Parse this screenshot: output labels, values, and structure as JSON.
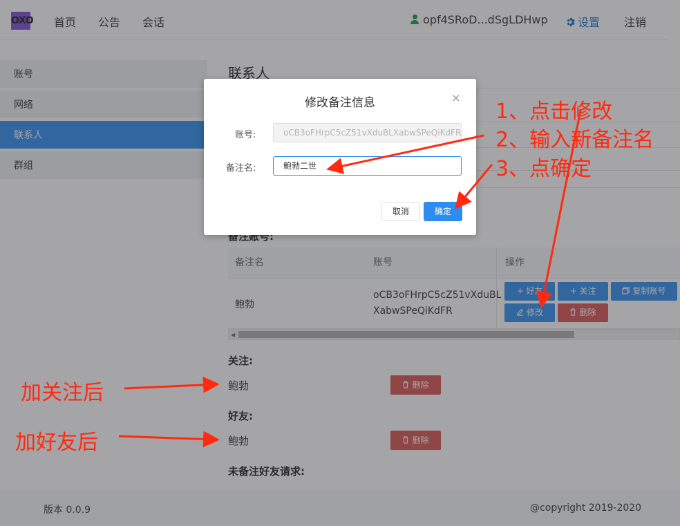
{
  "header": {
    "logo": "OXO",
    "nav": [
      "首页",
      "公告",
      "会话"
    ],
    "user": "opf4SRoD...dSgLDHwp",
    "settings": "设置",
    "logout": "注销"
  },
  "sidebar": {
    "items": [
      {
        "label": "账号"
      },
      {
        "label": "网络"
      },
      {
        "label": "联系人",
        "active": true
      },
      {
        "label": "群组"
      }
    ]
  },
  "main": {
    "title": "联系人",
    "remark_section": "备注账号:",
    "table": {
      "columns": [
        "备注名",
        "账号",
        "操作"
      ],
      "rows": [
        {
          "remark": "鲍勃",
          "account_line1": "oCB3oFHrpC5cZ51vXduBL",
          "account_line2": "XabwSPeQiKdFR",
          "actions": {
            "friend": "+ 好友",
            "follow": "+ 关注",
            "copy": "复制账号",
            "modify": "修改",
            "delete": "删除"
          }
        }
      ]
    },
    "follow_section": "关注:",
    "follow_items": [
      {
        "name": "鲍勃",
        "delete": "删除"
      }
    ],
    "friend_section": "好友:",
    "friend_items": [
      {
        "name": "鲍勃",
        "delete": "删除"
      }
    ],
    "pending_section": "未备注好友请求:"
  },
  "footer": {
    "version": "版本 0.0.9",
    "copyright": "@copyright 2019-2020"
  },
  "modal": {
    "title": "修改备注信息",
    "close": "×",
    "account_label": "账号:",
    "account_value": "oCB3oFHrpC5cZ51vXduBLXabwSPeQiKdFR",
    "remark_label": "备注名:",
    "remark_value": "鲍勃二世",
    "cancel": "取消",
    "ok": "确定"
  },
  "annotations": {
    "step1": "1、点击修改",
    "step2": "2、输入新备注名",
    "step3": "3、点确定",
    "after_follow": "加关注后",
    "after_friend": "加好友后"
  },
  "colors": {
    "primary": "#2d8cf0",
    "danger": "#d9534f",
    "annotation": "#ff2a10",
    "user_icon": "#1e9b3c"
  }
}
